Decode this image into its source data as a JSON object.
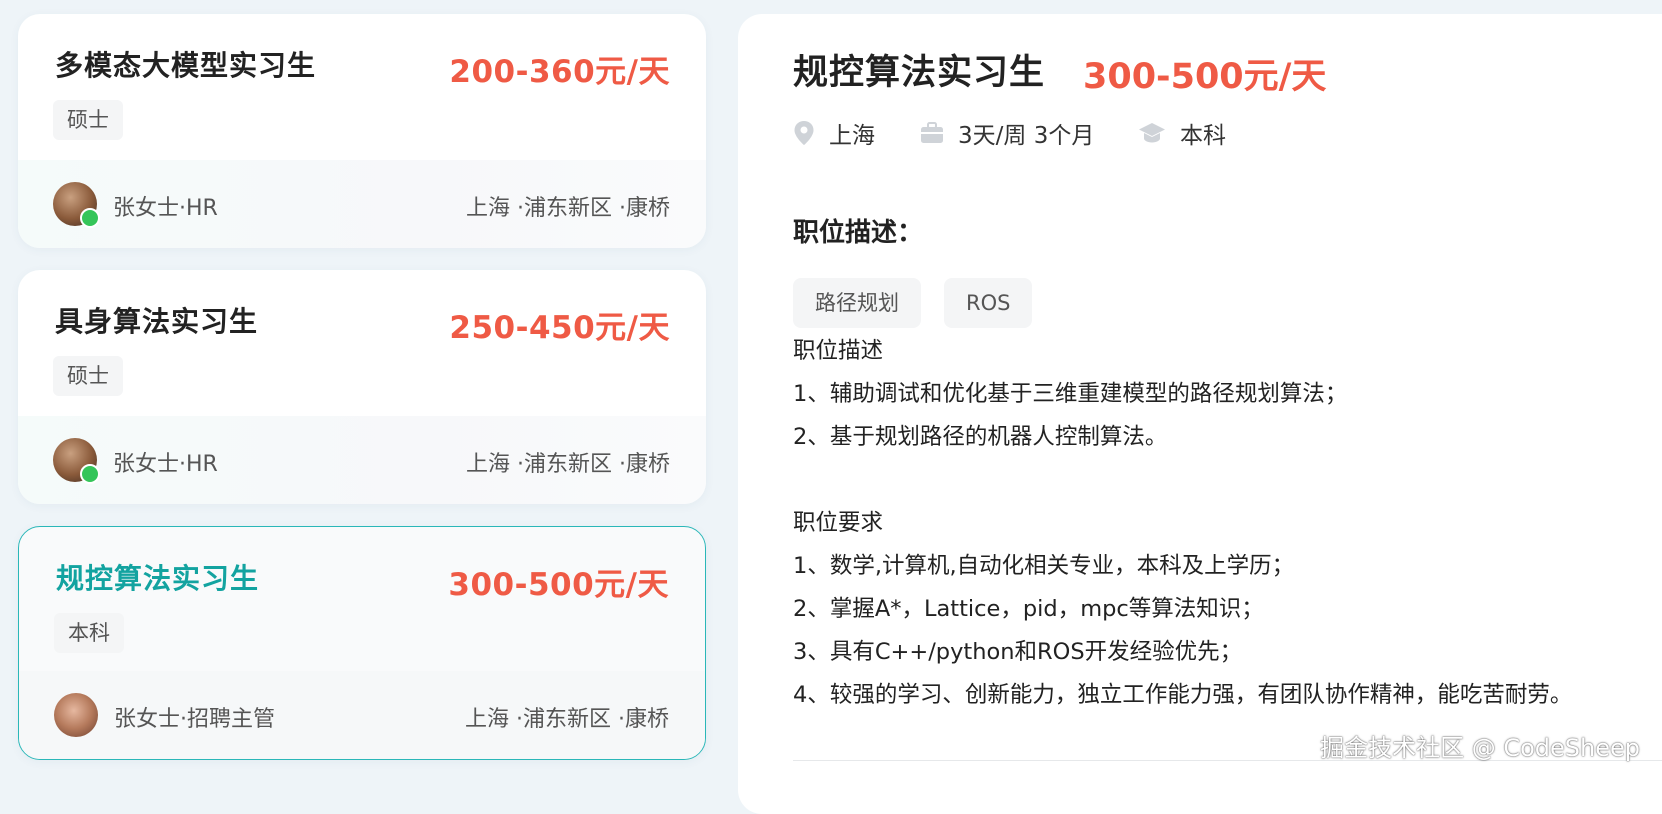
{
  "jobs": [
    {
      "title": "多模态大模型实习生",
      "salary": "200-360元/天",
      "tag": "硕士",
      "recruiter": "张女士·HR",
      "location": "上海 ·浦东新区 ·康桥"
    },
    {
      "title": "具身算法实习生",
      "salary": "250-450元/天",
      "tag": "硕士",
      "recruiter": "张女士·HR",
      "location": "上海 ·浦东新区 ·康桥"
    },
    {
      "title": "规控算法实习生",
      "salary": "300-500元/天",
      "tag": "本科",
      "recruiter": "张女士·招聘主管",
      "location": "上海 ·浦东新区 ·康桥"
    }
  ],
  "detail": {
    "title": "规控算法实习生",
    "salary": "300-500元/天",
    "city": "上海",
    "schedule": "3天/周 3个月",
    "education": "本科",
    "section_title": "职位描述：",
    "skills": [
      "路径规划",
      "ROS"
    ],
    "lines": [
      "职位描述",
      "1、辅助调试和优化基于三维重建模型的路径规划算法；",
      "2、基于规划路径的机器人控制算法。",
      "",
      "职位要求",
      "1、数学,计算机,自动化相关专业，本科及上学历；",
      "2、掌握A*，Lattice，pid，mpc等算法知识；",
      "3、具有C++/python和ROS开发经验优先；",
      "4、较强的学习、创新能力，独立工作能力强，有团队协作精神，能吃苦耐劳。"
    ]
  },
  "watermark": "掘金技术社区 @ CodeSheep",
  "icons": {
    "location": "location-pin-icon",
    "schedule": "briefcase-icon",
    "education": "graduation-cap-icon"
  },
  "colors": {
    "accent": "#13a3a0",
    "salary": "#ef5a45",
    "online": "#35c559"
  }
}
